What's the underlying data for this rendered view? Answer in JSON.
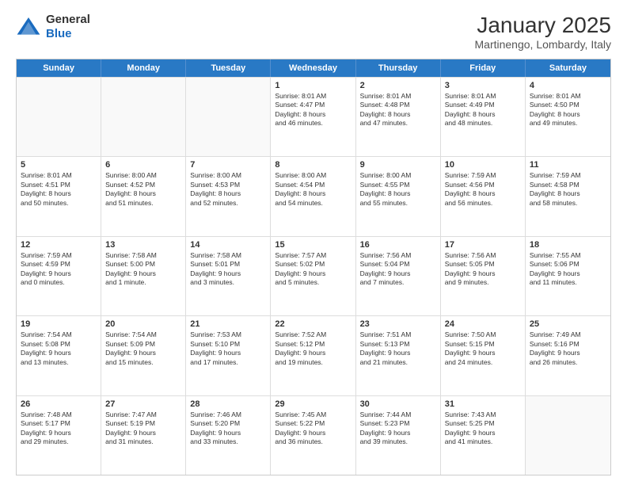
{
  "logo": {
    "general": "General",
    "blue": "Blue"
  },
  "title": "January 2025",
  "location": "Martinengo, Lombardy, Italy",
  "days": [
    "Sunday",
    "Monday",
    "Tuesday",
    "Wednesday",
    "Thursday",
    "Friday",
    "Saturday"
  ],
  "weeks": [
    [
      {
        "day": "",
        "empty": true
      },
      {
        "day": "",
        "empty": true
      },
      {
        "day": "",
        "empty": true
      },
      {
        "day": "1",
        "lines": [
          "Sunrise: 8:01 AM",
          "Sunset: 4:47 PM",
          "Daylight: 8 hours",
          "and 46 minutes."
        ]
      },
      {
        "day": "2",
        "lines": [
          "Sunrise: 8:01 AM",
          "Sunset: 4:48 PM",
          "Daylight: 8 hours",
          "and 47 minutes."
        ]
      },
      {
        "day": "3",
        "lines": [
          "Sunrise: 8:01 AM",
          "Sunset: 4:49 PM",
          "Daylight: 8 hours",
          "and 48 minutes."
        ]
      },
      {
        "day": "4",
        "lines": [
          "Sunrise: 8:01 AM",
          "Sunset: 4:50 PM",
          "Daylight: 8 hours",
          "and 49 minutes."
        ]
      }
    ],
    [
      {
        "day": "5",
        "lines": [
          "Sunrise: 8:01 AM",
          "Sunset: 4:51 PM",
          "Daylight: 8 hours",
          "and 50 minutes."
        ]
      },
      {
        "day": "6",
        "lines": [
          "Sunrise: 8:00 AM",
          "Sunset: 4:52 PM",
          "Daylight: 8 hours",
          "and 51 minutes."
        ]
      },
      {
        "day": "7",
        "lines": [
          "Sunrise: 8:00 AM",
          "Sunset: 4:53 PM",
          "Daylight: 8 hours",
          "and 52 minutes."
        ]
      },
      {
        "day": "8",
        "lines": [
          "Sunrise: 8:00 AM",
          "Sunset: 4:54 PM",
          "Daylight: 8 hours",
          "and 54 minutes."
        ]
      },
      {
        "day": "9",
        "lines": [
          "Sunrise: 8:00 AM",
          "Sunset: 4:55 PM",
          "Daylight: 8 hours",
          "and 55 minutes."
        ]
      },
      {
        "day": "10",
        "lines": [
          "Sunrise: 7:59 AM",
          "Sunset: 4:56 PM",
          "Daylight: 8 hours",
          "and 56 minutes."
        ]
      },
      {
        "day": "11",
        "lines": [
          "Sunrise: 7:59 AM",
          "Sunset: 4:58 PM",
          "Daylight: 8 hours",
          "and 58 minutes."
        ]
      }
    ],
    [
      {
        "day": "12",
        "lines": [
          "Sunrise: 7:59 AM",
          "Sunset: 4:59 PM",
          "Daylight: 9 hours",
          "and 0 minutes."
        ]
      },
      {
        "day": "13",
        "lines": [
          "Sunrise: 7:58 AM",
          "Sunset: 5:00 PM",
          "Daylight: 9 hours",
          "and 1 minute."
        ]
      },
      {
        "day": "14",
        "lines": [
          "Sunrise: 7:58 AM",
          "Sunset: 5:01 PM",
          "Daylight: 9 hours",
          "and 3 minutes."
        ]
      },
      {
        "day": "15",
        "lines": [
          "Sunrise: 7:57 AM",
          "Sunset: 5:02 PM",
          "Daylight: 9 hours",
          "and 5 minutes."
        ]
      },
      {
        "day": "16",
        "lines": [
          "Sunrise: 7:56 AM",
          "Sunset: 5:04 PM",
          "Daylight: 9 hours",
          "and 7 minutes."
        ]
      },
      {
        "day": "17",
        "lines": [
          "Sunrise: 7:56 AM",
          "Sunset: 5:05 PM",
          "Daylight: 9 hours",
          "and 9 minutes."
        ]
      },
      {
        "day": "18",
        "lines": [
          "Sunrise: 7:55 AM",
          "Sunset: 5:06 PM",
          "Daylight: 9 hours",
          "and 11 minutes."
        ]
      }
    ],
    [
      {
        "day": "19",
        "lines": [
          "Sunrise: 7:54 AM",
          "Sunset: 5:08 PM",
          "Daylight: 9 hours",
          "and 13 minutes."
        ]
      },
      {
        "day": "20",
        "lines": [
          "Sunrise: 7:54 AM",
          "Sunset: 5:09 PM",
          "Daylight: 9 hours",
          "and 15 minutes."
        ]
      },
      {
        "day": "21",
        "lines": [
          "Sunrise: 7:53 AM",
          "Sunset: 5:10 PM",
          "Daylight: 9 hours",
          "and 17 minutes."
        ]
      },
      {
        "day": "22",
        "lines": [
          "Sunrise: 7:52 AM",
          "Sunset: 5:12 PM",
          "Daylight: 9 hours",
          "and 19 minutes."
        ]
      },
      {
        "day": "23",
        "lines": [
          "Sunrise: 7:51 AM",
          "Sunset: 5:13 PM",
          "Daylight: 9 hours",
          "and 21 minutes."
        ]
      },
      {
        "day": "24",
        "lines": [
          "Sunrise: 7:50 AM",
          "Sunset: 5:15 PM",
          "Daylight: 9 hours",
          "and 24 minutes."
        ]
      },
      {
        "day": "25",
        "lines": [
          "Sunrise: 7:49 AM",
          "Sunset: 5:16 PM",
          "Daylight: 9 hours",
          "and 26 minutes."
        ]
      }
    ],
    [
      {
        "day": "26",
        "lines": [
          "Sunrise: 7:48 AM",
          "Sunset: 5:17 PM",
          "Daylight: 9 hours",
          "and 29 minutes."
        ]
      },
      {
        "day": "27",
        "lines": [
          "Sunrise: 7:47 AM",
          "Sunset: 5:19 PM",
          "Daylight: 9 hours",
          "and 31 minutes."
        ]
      },
      {
        "day": "28",
        "lines": [
          "Sunrise: 7:46 AM",
          "Sunset: 5:20 PM",
          "Daylight: 9 hours",
          "and 33 minutes."
        ]
      },
      {
        "day": "29",
        "lines": [
          "Sunrise: 7:45 AM",
          "Sunset: 5:22 PM",
          "Daylight: 9 hours",
          "and 36 minutes."
        ]
      },
      {
        "day": "30",
        "lines": [
          "Sunrise: 7:44 AM",
          "Sunset: 5:23 PM",
          "Daylight: 9 hours",
          "and 39 minutes."
        ]
      },
      {
        "day": "31",
        "lines": [
          "Sunrise: 7:43 AM",
          "Sunset: 5:25 PM",
          "Daylight: 9 hours",
          "and 41 minutes."
        ]
      },
      {
        "day": "",
        "empty": true
      }
    ]
  ]
}
